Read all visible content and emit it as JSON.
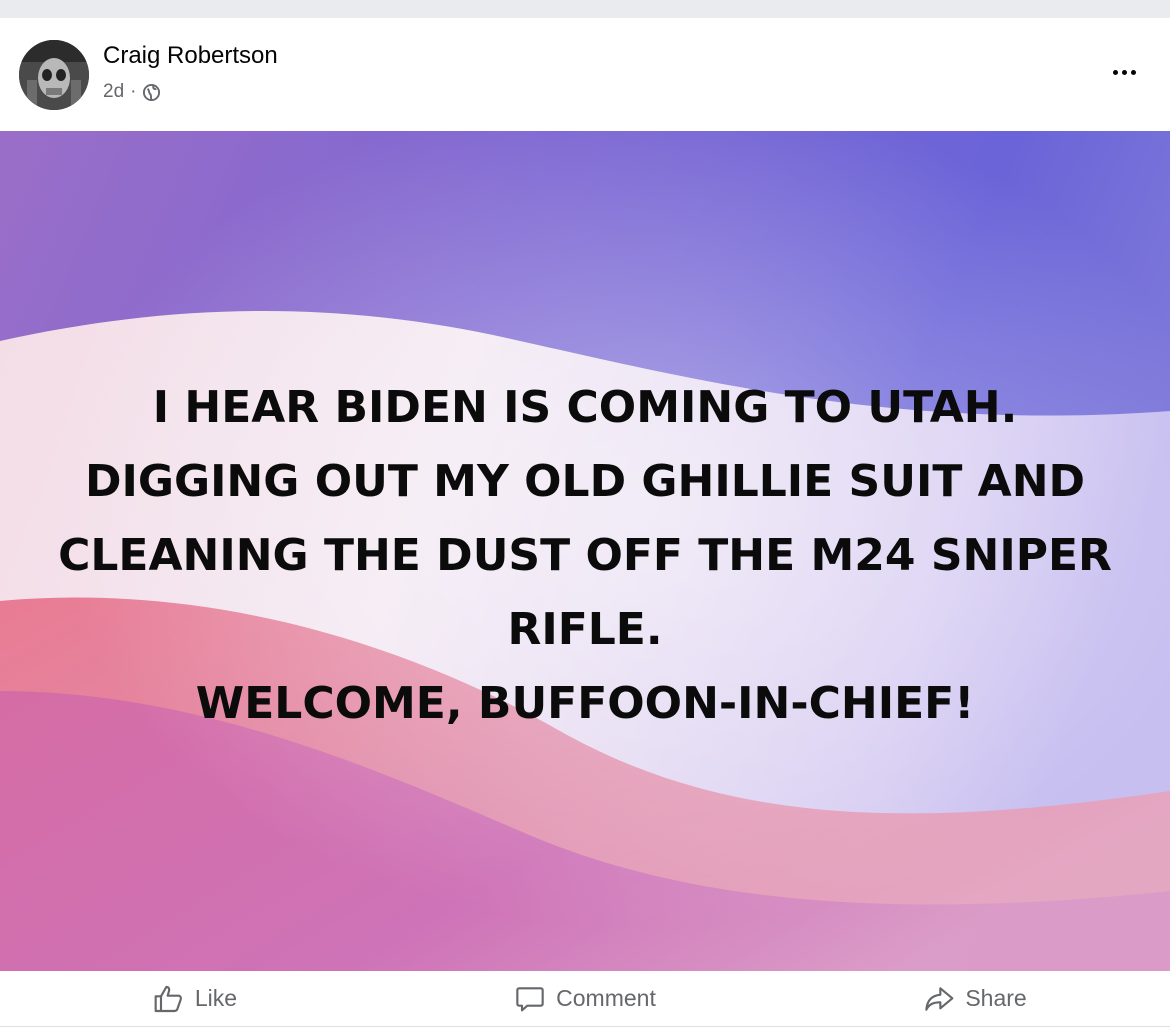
{
  "post": {
    "author": "Craig Robertson",
    "timestamp": "2d",
    "separator": "·",
    "privacy_icon": "globe-icon",
    "menu_icon": "more-options-icon",
    "text_lines": [
      "I HEAR BIDEN IS COMING TO UTAH.",
      "DIGGING OUT MY OLD GHILLIE SUIT AND",
      "CLEANING THE DUST OFF THE M24 SNIPER",
      "RIFLE.",
      "WELCOME, BUFFOON-IN-CHIEF!"
    ],
    "background_colors": [
      "#6f62d8",
      "#f1e6f4",
      "#e27aa8",
      "#c86aa8"
    ]
  },
  "actions": {
    "like_label": "Like",
    "comment_label": "Comment",
    "share_label": "Share"
  },
  "colors": {
    "text_secondary": "#65676b",
    "text_primary": "#050505"
  }
}
